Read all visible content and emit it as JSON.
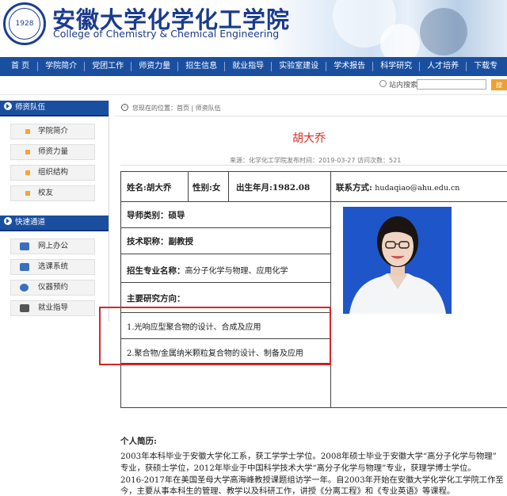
{
  "header": {
    "title": "安徽大学化学化工学院",
    "subtitle": "College of Chemistry & Chemical Engineering",
    "logo_text": "1928"
  },
  "nav": {
    "items": [
      "首  页",
      "学院简介",
      "党团工作",
      "师资力量",
      "招生信息",
      "就业指导",
      "实验室建设",
      "学术报告",
      "科学研究",
      "人才培养",
      "下载专"
    ]
  },
  "search": {
    "label": "站内搜索",
    "placeholder": "",
    "button": "搜"
  },
  "sidebar": {
    "section1_title": "师资队伍",
    "section1_items": [
      "学院简介",
      "师资力量",
      "组织结构",
      "校友"
    ],
    "section2_title": "快速通道",
    "section2_items": [
      "网上办公",
      "选课系统",
      "仪器预约",
      "就业指导"
    ]
  },
  "breadcrumb": "您现在的位置：首页 | 师资队伍",
  "article": {
    "title": "胡大乔",
    "meta": "来源：化学化工学院发布时间：2019-03-27   访问次数：521"
  },
  "profile": {
    "name": "姓名:胡大乔",
    "gender": "性别:女",
    "birth": "出生年月:1982.08",
    "contact_label": "联系方式:",
    "contact_value": "hudaqiao@ahu.edu.cn",
    "supervisor_label": "导师类别：",
    "supervisor_value": "硕导",
    "title_label": "技术职称：",
    "title_value": "副教授",
    "major_label": "招生专业名称：",
    "major_value": "高分子化学与物理、应用化学",
    "research_label": "主要研究方向：",
    "research_1": "1.光响应型聚合物的设计、合成及应用",
    "research_2": "2.聚合物/金属纳米颗粒复合物的设计、制备及应用"
  },
  "bio": {
    "heading": "个人简历:",
    "lines": [
      "2003年本科毕业于安徽大学化工系，获工学学士学位。2008年硕士毕业于安徽大学“高分子化学与物理”",
      "专业，获硕士学位，2012年毕业于中国科学技术大学“高分子化学与物理”专业，获理学博士学位。",
      "2016-2017年在美国圣母大学高海峰教授课题组访学一年。自2003年开始在安徽大学化学化工学院工作至",
      "今，主要从事本科生的管理、教学以及科研工作，讲授《分离工程》和《专业英语》等课程。"
    ]
  },
  "colors": {
    "brand_blue": "#1a4fa0",
    "title_red": "#d7261d",
    "highlight_red": "#d9252a",
    "bullet_orange": "#f2a53b",
    "photo_bg": "#1e56c9"
  }
}
